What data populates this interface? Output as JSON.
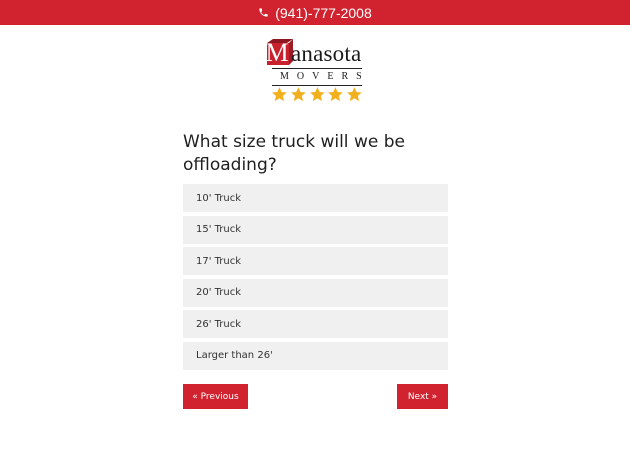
{
  "header": {
    "phone": "(941)-777-2008",
    "phone_icon": "phone-icon",
    "background_color": "#d0232f"
  },
  "logo": {
    "initial": "M",
    "wordmark": "anasota",
    "tagline": "MOVERS",
    "brand_color": "#c8202c",
    "rating_stars": 5,
    "star_color": "#f2b01e"
  },
  "form": {
    "question": "What size truck will we be offloading?",
    "options": [
      {
        "label": "10' Truck"
      },
      {
        "label": "15' Truck"
      },
      {
        "label": "17' Truck"
      },
      {
        "label": "20' Truck"
      },
      {
        "label": "26' Truck"
      },
      {
        "label": "Larger than 26'"
      }
    ],
    "previous_label": "« Previous",
    "next_label": "Next »"
  }
}
